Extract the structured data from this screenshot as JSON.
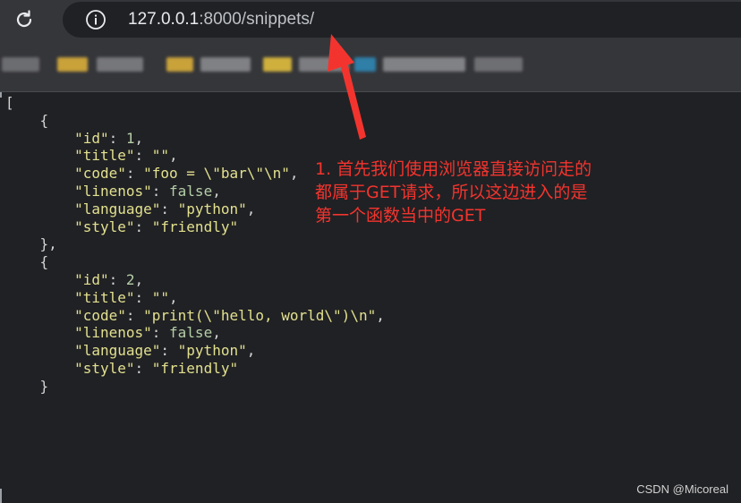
{
  "address_bar": {
    "host": "127.0.0.1",
    "path": ":8000/snippets/"
  },
  "json_view": {
    "open_bracket": "[",
    "records": [
      {
        "id": "1",
        "title": "\"\"",
        "code": "\"foo = \\\"bar\\\"\\n\"",
        "linenos": "false",
        "language": "\"python\"",
        "style": "\"friendly\""
      },
      {
        "id": "2",
        "title": "\"\"",
        "code": "\"print(\\\"hello, world\\\")\\n\"",
        "linenos": "false",
        "language": "\"python\"",
        "style": "\"friendly\""
      }
    ]
  },
  "annotation": {
    "line1": "1. 首先我们使用浏览器直接访问走的",
    "line2": "都属于GET请求，所以这边进入的是",
    "line3": "第一个函数当中的GET",
    "color": "#f3342e"
  },
  "watermark": "CSDN @Micoreal"
}
